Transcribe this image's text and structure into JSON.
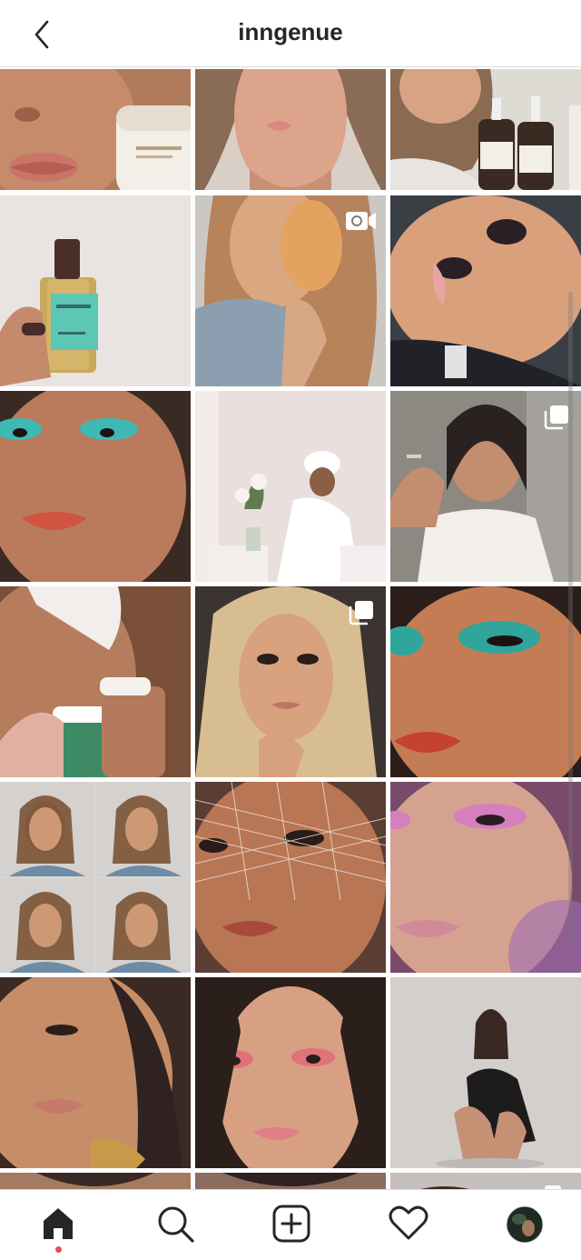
{
  "header": {
    "title": "inngenue",
    "back_icon": "chevron-left-icon"
  },
  "grid": {
    "badges": [
      {
        "tile": 5,
        "icon": "igtv-video-icon"
      },
      {
        "tile": 9,
        "icon": "carousel-icon"
      },
      {
        "tile": 12,
        "icon": "carousel-icon"
      },
      {
        "tile": 21,
        "icon": "carousel-icon"
      }
    ]
  },
  "tabbar": {
    "tabs": [
      {
        "name": "home",
        "icon": "home-icon",
        "active": true,
        "notification": true
      },
      {
        "name": "search",
        "icon": "search-icon"
      },
      {
        "name": "new-post",
        "icon": "plus-square-icon"
      },
      {
        "name": "activity",
        "icon": "heart-icon"
      },
      {
        "name": "profile",
        "icon": "avatar"
      }
    ]
  },
  "colors": {
    "notification": "#ed4956",
    "text": "#262626",
    "divider": "#dbdbdb"
  }
}
